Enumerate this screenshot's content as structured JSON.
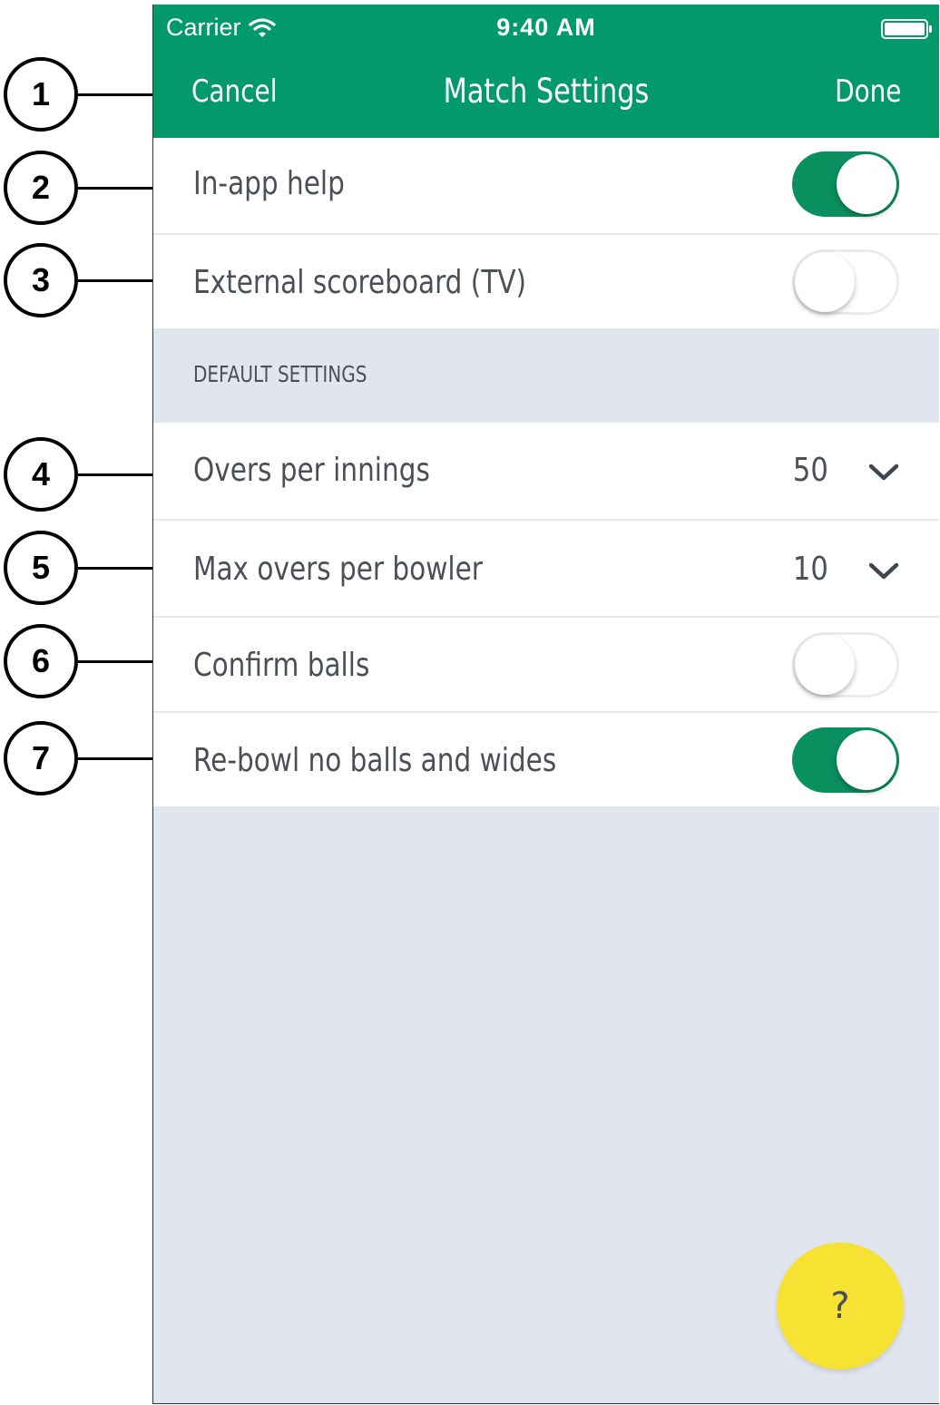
{
  "status_bar": {
    "carrier": "Carrier",
    "time": "9:40 AM"
  },
  "nav": {
    "cancel_label": "Cancel",
    "title": "Match Settings",
    "done_label": "Done"
  },
  "settings": {
    "in_app_help": {
      "label": "In-app help",
      "enabled": true
    },
    "external_scoreboard": {
      "label": "External scoreboard (TV)",
      "enabled": false
    },
    "section_header": "DEFAULT SETTINGS",
    "overs_per_innings": {
      "label": "Overs per innings",
      "value": "50"
    },
    "max_overs_per_bowler": {
      "label": "Max overs per bowler",
      "value": "10"
    },
    "confirm_balls": {
      "label": "Confirm balls",
      "enabled": false
    },
    "rebowl": {
      "label": "Re-bowl no balls and wides",
      "enabled": true
    }
  },
  "help_button": {
    "label": "?"
  },
  "callouts": [
    "1",
    "2",
    "3",
    "4",
    "5",
    "6",
    "7"
  ],
  "colors": {
    "brand_green": "#039a6b",
    "toggle_on": "#0a8f5e",
    "background": "#e1e5ee",
    "help_yellow": "#f6e232"
  },
  "icons": [
    "wifi-icon",
    "battery-icon",
    "chevron-down-icon"
  ]
}
